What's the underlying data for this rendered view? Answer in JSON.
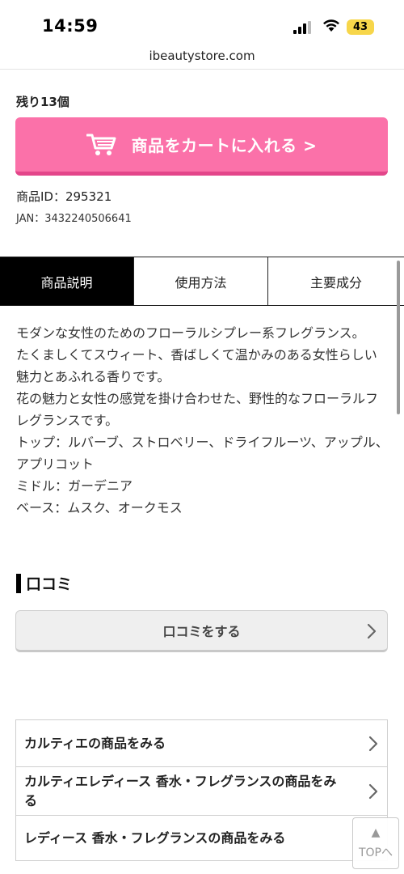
{
  "status_bar": {
    "time": "14:59",
    "battery": "43",
    "icons": [
      "signal-icon",
      "wifi-icon",
      "battery-icon"
    ]
  },
  "url_bar": {
    "domain": "ibeautystore.com"
  },
  "product": {
    "stock_text": "残り13個",
    "cart_button_label": "商品をカートに入れる >",
    "product_id": "商品ID：295321",
    "jan": "JAN：3432240506641"
  },
  "tabs": [
    {
      "label": "商品説明",
      "active": true
    },
    {
      "label": "使用方法",
      "active": false
    },
    {
      "label": "主要成分",
      "active": false
    }
  ],
  "description": {
    "lines": [
      "モダンな女性のためのフローラルシプレー系フレグランス。",
      "たくましくてスウィート、香ばしくて温かみのある女性らしい魅力とあふれる香りです。",
      "花の魅力と女性の感覚を掛け合わせた、野性的なフローラルフレグランスです。",
      "トップ：ルバーブ、ストロベリー、ドライフルーツ、アップル、アプリコット",
      "ミドル：ガーデニア",
      "ベース：ムスク、オークモス"
    ]
  },
  "reviews": {
    "heading": "口コミ",
    "write_button_label": "口コミをする"
  },
  "links": [
    {
      "label": "カルティエの商品をみる"
    },
    {
      "label": "カルティエレディース 香水・フレグランスの商品をみる"
    },
    {
      "label": "レディース 香水・フレグランスの商品をみる"
    }
  ],
  "top_button": {
    "arrow": "▲",
    "label": "TOPへ"
  },
  "colors": {
    "cart_button": "#fb71a9",
    "cart_button_shadow": "#e3468a",
    "active_tab": "#000000",
    "battery": "#f7d64a"
  }
}
